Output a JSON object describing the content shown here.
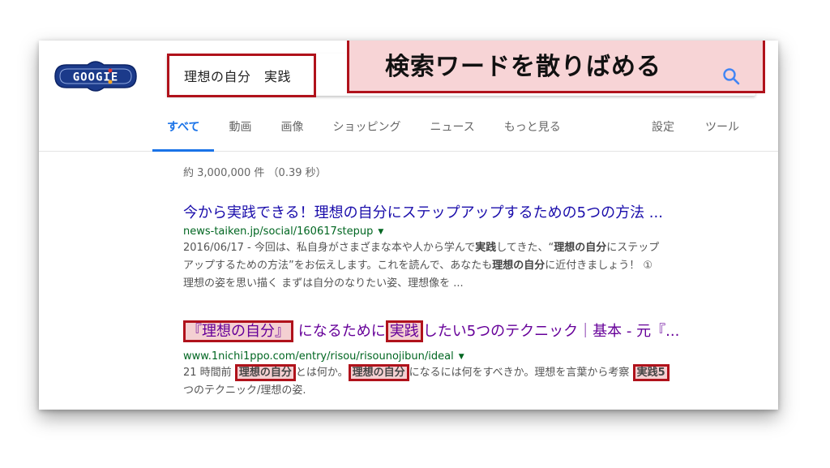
{
  "logo": {
    "text": "GOOGIE",
    "colors": {
      "body": "#1b3a8a",
      "accent": "#e53935",
      "gold": "#f9a825"
    }
  },
  "search": {
    "query": "理想の自分　実践",
    "icon": "search-icon"
  },
  "annotation": {
    "banner": "検索ワードを散りばめる"
  },
  "tabs": [
    {
      "label": "すべて",
      "active": true
    },
    {
      "label": "動画"
    },
    {
      "label": "画像"
    },
    {
      "label": "ショッピング"
    },
    {
      "label": "ニュース"
    },
    {
      "label": "もっと見る"
    }
  ],
  "tab_settings": "設定",
  "tab_tools": "ツール",
  "stats": "約 3,000,000 件 （0.39 秒）",
  "results": [
    {
      "title": "今から実践できる！理想の自分にステップアップするための5つの方法 ...",
      "url": "news-taiken.jp/social/160617stepup",
      "snippet": {
        "line1_a": "2016/06/17 - 今回は、私自身がさまざまな本や人から学んで",
        "line1_b1": "実践",
        "line1_c": "してきた、“",
        "line1_b2": "理想の自分",
        "line1_d": "にステップ",
        "line2_a": "アップするための方法”をお伝えします。これを読んで、あなたも",
        "line2_b": "理想の自分",
        "line2_c": "に近付きましょう！ ①",
        "line3": "理想の姿を思い描く まずは自分のなりたい姿、理想像を ..."
      }
    },
    {
      "title_hl1": "『理想の自分』",
      "title_mid": "になるために",
      "title_hl2": "実践",
      "title_end": "したい5つのテクニック｜基本 - 元『...",
      "url": "www.1nichi1ppo.com/entry/risou/risounojibun/ideal",
      "snippet": {
        "line1_a": "21 時間前 ",
        "line1_hl1": "理想の自分",
        "line1_b": "とは何か。",
        "line1_hl2": "理想の自分",
        "line1_c": "になるには何をすべきか。理想を言葉から考察 ",
        "line1_hl3": "実践5",
        "line2": "つのテクニック/理想の姿."
      }
    }
  ]
}
